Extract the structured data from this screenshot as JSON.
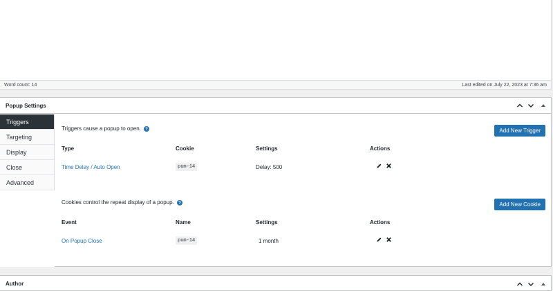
{
  "status_bar": {
    "word_count": "Word count: 14",
    "last_edited": "Last edited on July 22, 2023 at 7:36 am"
  },
  "popup_settings": {
    "title": "Popup Settings",
    "tabs": [
      {
        "label": "Triggers",
        "active": true
      },
      {
        "label": "Targeting",
        "active": false
      },
      {
        "label": "Display",
        "active": false
      },
      {
        "label": "Close",
        "active": false
      },
      {
        "label": "Advanced",
        "active": false
      }
    ],
    "triggers": {
      "description": "Triggers cause a popup to open.",
      "add_button": "Add New Trigger",
      "headers": [
        "Type",
        "Cookie",
        "Settings",
        "Actions"
      ],
      "rows": [
        {
          "type": "Time Delay / Auto Open",
          "cookie": "pum-14",
          "settings": "Delay: 500"
        }
      ]
    },
    "cookies": {
      "description": "Cookies control the repeat display of a popup.",
      "add_button": "Add New Cookie",
      "headers": [
        "Event",
        "Name",
        "Settings",
        "Actions"
      ],
      "rows": [
        {
          "event": "On Popup Close",
          "name": "pum-14",
          "settings": "1 month"
        }
      ]
    }
  },
  "author": {
    "title": "Author"
  },
  "icons": {
    "move_up": "chevron-up-icon",
    "move_down": "chevron-down-icon",
    "toggle": "triangle-up-icon",
    "help": "help-circle-icon",
    "edit": "pencil-icon",
    "remove": "close-icon"
  },
  "colors": {
    "accent": "#2271b1",
    "active_tab": "#2c3338",
    "border": "#c3c4c7"
  }
}
